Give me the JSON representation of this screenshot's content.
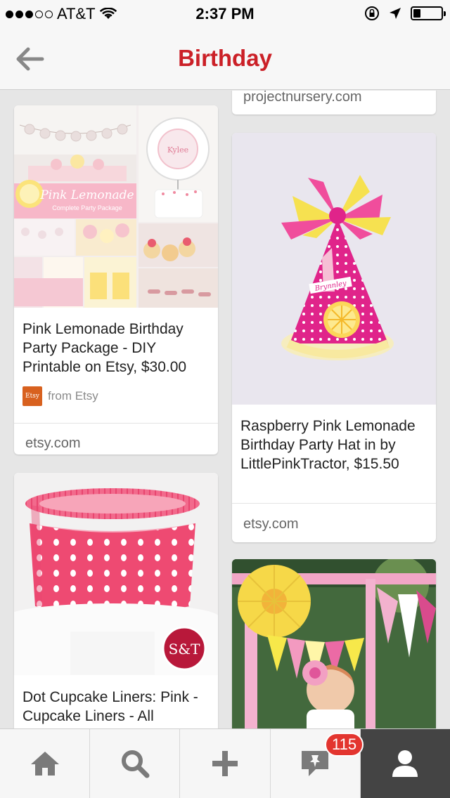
{
  "status_bar": {
    "carrier": "AT&T",
    "time": "2:37 PM",
    "signal_bars": [
      true,
      true,
      true,
      false,
      false
    ]
  },
  "nav": {
    "title": "Birthday"
  },
  "pins": {
    "top_right_source": "projectnursery.com",
    "pin1": {
      "image_text_title": "Pink Lemonade",
      "image_text_subtitle": "Complete Party Package",
      "image_text_topper": "Kylee",
      "description": "Pink Lemonade Birthday Party Package - DIY Printable on Etsy, $30.00",
      "attribution_label": "from Etsy",
      "attribution_logo": "Etsy",
      "source": "etsy.com"
    },
    "pin2": {
      "hat_name": "Brynnley",
      "description": "Raspberry Pink Lemonade Birthday Party Hat in by LittlePinkTractor, $15.50",
      "source": "etsy.com"
    },
    "pin3": {
      "logo_text": "S&T",
      "description": "Dot Cupcake Liners: Pink - Cupcake Liners - All Products: Erin just requested the cupca..."
    }
  },
  "tabbar": {
    "notification_count": "115",
    "tabs": [
      "home-icon",
      "search-icon",
      "add-icon",
      "notifications-icon",
      "profile-icon"
    ]
  },
  "colors": {
    "accent": "#cb2027",
    "badge": "#e3352f",
    "active_tab": "#444444"
  }
}
